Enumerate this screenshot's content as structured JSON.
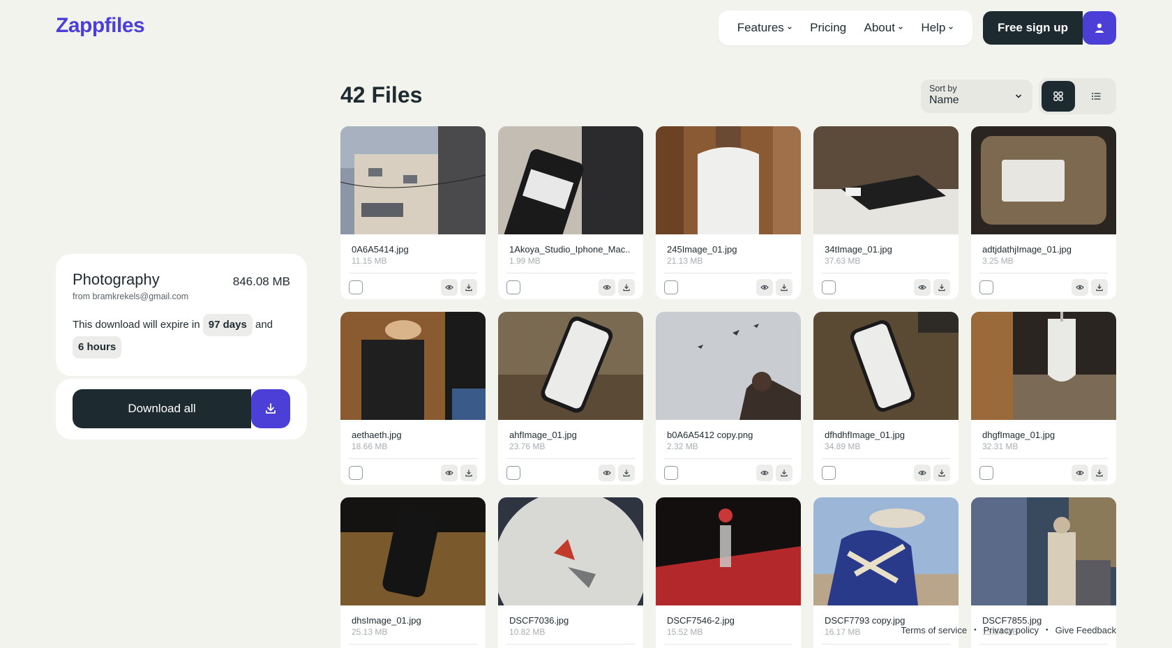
{
  "brand": {
    "name": "Zappfiles",
    "color": "#4b3fd8"
  },
  "nav": {
    "items": [
      {
        "label": "Features",
        "has_menu": true
      },
      {
        "label": "Pricing",
        "has_menu": false
      },
      {
        "label": "About",
        "has_menu": true
      },
      {
        "label": "Help",
        "has_menu": true
      }
    ],
    "signup_label": "Free sign up",
    "user_icon": "user-icon"
  },
  "collection": {
    "title": "Photography",
    "size": "846.08 MB",
    "from": "from bramkrekels@gmail.com",
    "expiry_prefix": "This download will expire in",
    "days": "97 days",
    "and": "and",
    "hours": "6 hours",
    "download_all_label": "Download all"
  },
  "files_header": {
    "title": "42 Files",
    "sort_label": "Sort by",
    "sort_value": "Name",
    "view": "grid"
  },
  "files": [
    {
      "name": "0A6A5414.jpg",
      "size": "11.15 MB"
    },
    {
      "name": "1Akoya_Studio_Iphone_Mac..",
      "size": "1.99 MB"
    },
    {
      "name": "245Image_01.jpg",
      "size": "21.13 MB"
    },
    {
      "name": "34tImage_01.jpg",
      "size": "37.63 MB"
    },
    {
      "name": "adtjdathjImage_01.jpg",
      "size": "3.25 MB"
    },
    {
      "name": "aethaeth.jpg",
      "size": "18.66 MB"
    },
    {
      "name": "ahfImage_01.jpg",
      "size": "23.76 MB"
    },
    {
      "name": "b0A6A5412 copy.png",
      "size": "2.32 MB"
    },
    {
      "name": "dfhdhfImage_01.jpg",
      "size": "34.89 MB"
    },
    {
      "name": "dhgfImage_01.jpg",
      "size": "32.31 MB"
    },
    {
      "name": "dhsImage_01.jpg",
      "size": "25.13 MB"
    },
    {
      "name": "DSCF7036.jpg",
      "size": "10.82 MB"
    },
    {
      "name": "DSCF7546-2.jpg",
      "size": "15.52 MB"
    },
    {
      "name": "DSCF7793 copy.jpg",
      "size": "16.17 MB"
    },
    {
      "name": "DSCF7855.jpg",
      "size": "13.84 MB"
    }
  ],
  "footer": {
    "terms": "Terms of service",
    "privacy": "Privacy policy",
    "feedback": "Give Feedback",
    "separator": "•"
  }
}
